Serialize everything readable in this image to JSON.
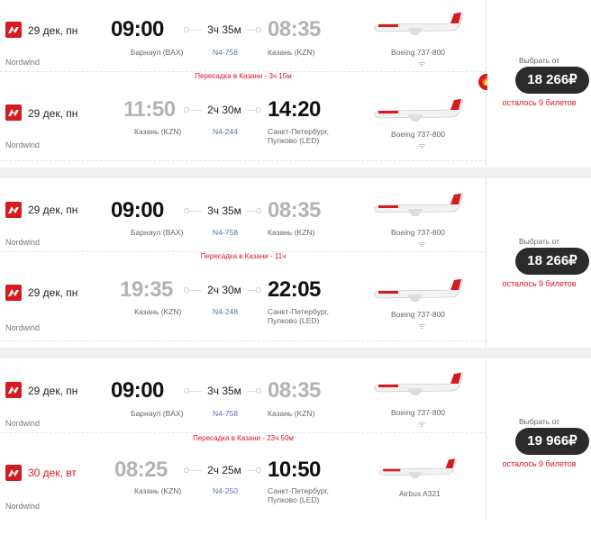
{
  "colors": {
    "brand": "#d71920",
    "price_bg": "#2b2b2b",
    "flight_number": "#4a7ab5"
  },
  "icons": {
    "airline_logo": "nordwind-logo-icon",
    "connector": "route-dot-icon",
    "plane": "airplane-icon",
    "wifi": "wifi-icon",
    "badge": "fire-icon"
  },
  "offers": [
    {
      "segments": [
        {
          "date": "29 дек, пн",
          "airline": "Nordwind",
          "dep_time": "09:00",
          "dep_city": "Барнаул (BAX)",
          "duration": "3ч 35м",
          "flight": "N4-758",
          "arr_time": "08:35",
          "arr_city": [
            "Казань (KZN)"
          ],
          "aircraft": "Boeing 737-800"
        },
        {
          "date": "29 дек, пн",
          "airline": "Nordwind",
          "dep_time": "11:50",
          "dep_city": "Казань (KZN)",
          "duration": "2ч 30м",
          "flight": "N4-244",
          "arr_time": "14:20",
          "arr_city": [
            "Санкт-Петербург,",
            "Пулково (LED)"
          ],
          "aircraft": "Boeing 737-800"
        }
      ],
      "transfer": "Пересадка в Казани - 3ч 15м",
      "choose_label": "Выбрать от",
      "price": "18 266₽",
      "seats_left": "осталось 9 билетов"
    },
    {
      "segments": [
        {
          "date": "29 дек, пн",
          "airline": "Nordwind",
          "dep_time": "09:00",
          "dep_city": "Барнаул (BAX)",
          "duration": "3ч 35м",
          "flight": "N4-758",
          "arr_time": "08:35",
          "arr_city": [
            "Казань (KZN)"
          ],
          "aircraft": "Boeing 737-800"
        },
        {
          "date": "29 дек, пн",
          "airline": "Nordwind",
          "dep_time": "19:35",
          "dep_city": "Казань (KZN)",
          "duration": "2ч 30м",
          "flight": "N4-248",
          "arr_time": "22:05",
          "arr_city": [
            "Санкт-Петербург,",
            "Пулково (LED)"
          ],
          "aircraft": "Boeing 737-800"
        }
      ],
      "transfer": "Пересадка в Казани - 11ч",
      "choose_label": "Выбрать от",
      "price": "18 266₽",
      "seats_left": "осталось 9 билетов"
    },
    {
      "segments": [
        {
          "date": "29 дек, пн",
          "airline": "Nordwind",
          "dep_time": "09:00",
          "dep_city": "Барнаул (BAX)",
          "duration": "3ч 35м",
          "flight": "N4-758",
          "arr_time": "08:35",
          "arr_city": [
            "Казань (KZN)"
          ],
          "aircraft": "Boeing 737-800"
        },
        {
          "date": "30 дек, вт",
          "airline": "Nordwind",
          "dep_time": "08:25",
          "dep_city": "Казань (KZN)",
          "duration": "2ч 25м",
          "flight": "N4-250",
          "arr_time": "10:50",
          "arr_city": [
            "Санкт-Петербург,",
            "Пулково (LED)"
          ],
          "aircraft": "Airbus A321"
        }
      ],
      "transfer": "Пересадка в Казани - 23ч 50м",
      "choose_label": "Выбрать от",
      "price": "19 966₽",
      "seats_left": "осталось 9 билетов"
    }
  ]
}
